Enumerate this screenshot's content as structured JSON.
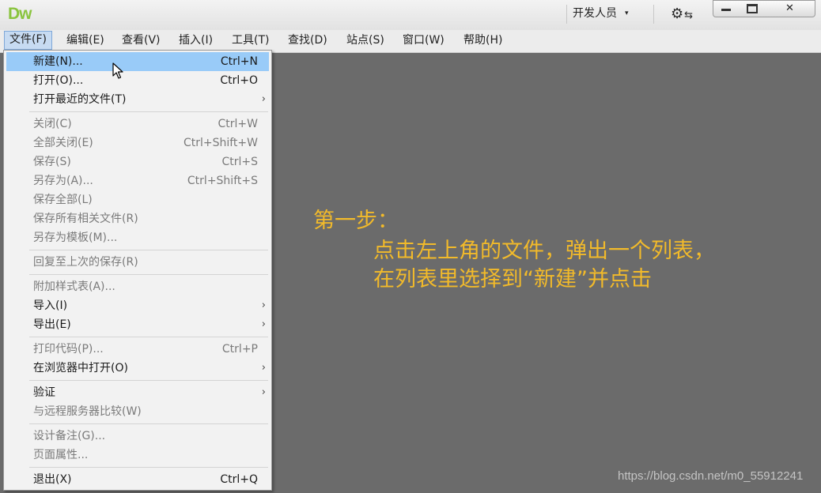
{
  "app": {
    "logo": "Dw"
  },
  "titlebar": {
    "workspace_label": "开发人员",
    "workspace_caret": "▾",
    "sync_icon": "gear-sync-icon",
    "close_glyph": "✕"
  },
  "menubar": {
    "items": [
      {
        "label": "文件(F)"
      },
      {
        "label": "编辑(E)"
      },
      {
        "label": "查看(V)"
      },
      {
        "label": "插入(I)"
      },
      {
        "label": "工具(T)"
      },
      {
        "label": "查找(D)"
      },
      {
        "label": "站点(S)"
      },
      {
        "label": "窗口(W)"
      },
      {
        "label": "帮助(H)"
      }
    ]
  },
  "file_menu": {
    "items": [
      {
        "label": "新建(N)...",
        "shortcut": "Ctrl+N",
        "enabled": true,
        "highlighted": true
      },
      {
        "label": "打开(O)...",
        "shortcut": "Ctrl+O",
        "enabled": true
      },
      {
        "label": "打开最近的文件(T)",
        "submenu": true,
        "enabled": true
      },
      {
        "label": "关闭(C)",
        "shortcut": "Ctrl+W",
        "enabled": false
      },
      {
        "label": "全部关闭(E)",
        "shortcut": "Ctrl+Shift+W",
        "enabled": false
      },
      {
        "label": "保存(S)",
        "shortcut": "Ctrl+S",
        "enabled": false
      },
      {
        "label": "另存为(A)...",
        "shortcut": "Ctrl+Shift+S",
        "enabled": false
      },
      {
        "label": "保存全部(L)",
        "enabled": false
      },
      {
        "label": "保存所有相关文件(R)",
        "enabled": false
      },
      {
        "label": "另存为模板(M)...",
        "enabled": false
      },
      {
        "label": "回复至上次的保存(R)",
        "enabled": false
      },
      {
        "label": "附加样式表(A)...",
        "enabled": false
      },
      {
        "label": "导入(I)",
        "submenu": true,
        "enabled": true
      },
      {
        "label": "导出(E)",
        "submenu": true,
        "enabled": true
      },
      {
        "label": "打印代码(P)...",
        "shortcut": "Ctrl+P",
        "enabled": false
      },
      {
        "label": "在浏览器中打开(O)",
        "submenu": true,
        "enabled": true
      },
      {
        "label": "验证",
        "submenu": true,
        "enabled": true
      },
      {
        "label": "与远程服务器比较(W)",
        "enabled": false
      },
      {
        "label": "设计备注(G)...",
        "enabled": false
      },
      {
        "label": "页面属性...",
        "enabled": false
      },
      {
        "label": "退出(X)",
        "shortcut": "Ctrl+Q",
        "enabled": true
      }
    ],
    "submenu_arrow": "›"
  },
  "annotation": {
    "line1": "第一步：",
    "line2": "点击左上角的文件，弹出一个列表，",
    "line3": "在列表里选择到“新建”并点击"
  },
  "watermark": "https://blog.csdn.net/m0_55912241",
  "colors": {
    "canvas": "#6b6b6b",
    "highlight": "#99cbf8",
    "annotation": "#f2ba2a",
    "logo": "#8ac43f"
  }
}
